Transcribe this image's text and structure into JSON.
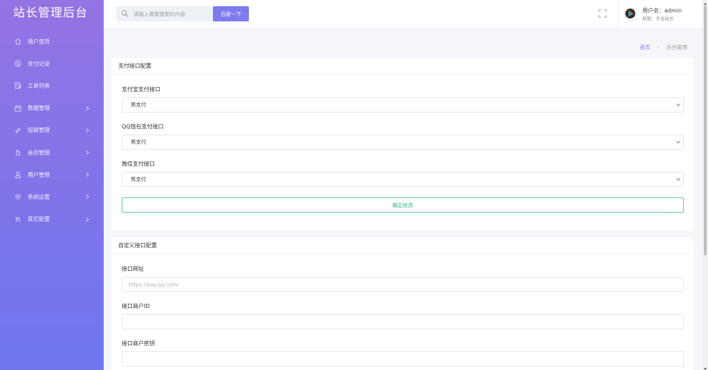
{
  "brand": {
    "title": "站长管理后台"
  },
  "sidebar": {
    "items": [
      {
        "label": "用户首页",
        "icon": "home-icon",
        "has_submenu": false
      },
      {
        "label": "支付记录",
        "icon": "yen-icon",
        "has_submenu": false
      },
      {
        "label": "工单列表",
        "icon": "edit-icon",
        "has_submenu": false
      },
      {
        "label": "数据管理",
        "icon": "calendar-icon",
        "has_submenu": true
      },
      {
        "label": "短链管理",
        "icon": "link-icon",
        "has_submenu": true
      },
      {
        "label": "会员管理",
        "icon": "fire-icon",
        "has_submenu": true
      },
      {
        "label": "用户管理",
        "icon": "user-icon",
        "has_submenu": true
      },
      {
        "label": "系统设置",
        "icon": "gear-icon",
        "has_submenu": true
      },
      {
        "label": "其它配置",
        "icon": "tools-icon",
        "has_submenu": true
      }
    ]
  },
  "topbar": {
    "search_placeholder": "请输入需要搜索的内容",
    "search_button": "百度一下",
    "user_name": "用户名：admin",
    "user_role": "权限：平台站长"
  },
  "breadcrumb": {
    "home": "首页",
    "separator": "›",
    "current": "后台管理"
  },
  "payment_card": {
    "title": "支付接口配置",
    "fields": [
      {
        "label": "支付宝支付接口",
        "value": "易支付"
      },
      {
        "label": "QQ钱包支付接口",
        "value": "易支付"
      },
      {
        "label": "微信支付接口",
        "value": "易支付"
      }
    ],
    "submit_label": "确定修改"
  },
  "custom_card": {
    "title": "自定义接口配置",
    "fields": [
      {
        "label": "接口网址",
        "value": "",
        "placeholder": "https://pay.qq.com/"
      },
      {
        "label": "接口商户ID",
        "value": "",
        "placeholder": ""
      },
      {
        "label": "接口商户密钥",
        "value": "",
        "placeholder": ""
      }
    ]
  },
  "colors": {
    "sidebar_top": "#9473e3",
    "sidebar_bottom": "#6f78ee",
    "accent": "#7e7bf0",
    "submit_green": "#30b88a"
  }
}
